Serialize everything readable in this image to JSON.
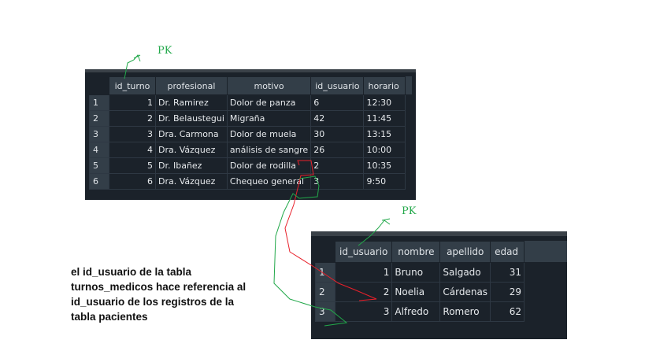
{
  "turnos_table": {
    "columns": [
      "id_turno",
      "profesional",
      "motivo",
      "id_usuario",
      "horario"
    ],
    "rows": [
      {
        "rn": "1",
        "id_turno": "1",
        "profesional": "Dr. Ramirez",
        "motivo": "Dolor de panza",
        "id_usuario": "6",
        "horario": "12:30"
      },
      {
        "rn": "2",
        "id_turno": "2",
        "profesional": "Dr. Belaustegui",
        "motivo": "Migraña",
        "id_usuario": "42",
        "horario": "11:45"
      },
      {
        "rn": "3",
        "id_turno": "3",
        "profesional": "Dra. Carmona",
        "motivo": "Dolor de muela",
        "id_usuario": "30",
        "horario": "13:15"
      },
      {
        "rn": "4",
        "id_turno": "4",
        "profesional": "Dra. Vázquez",
        "motivo": "análisis de sangre",
        "id_usuario": "26",
        "horario": "10:00"
      },
      {
        "rn": "5",
        "id_turno": "5",
        "profesional": "Dr. Ibañez",
        "motivo": "Dolor de rodilla",
        "id_usuario": "2",
        "horario": "10:35"
      },
      {
        "rn": "6",
        "id_turno": "6",
        "profesional": "Dra. Vázquez",
        "motivo": "Chequeo general",
        "id_usuario": "3",
        "horario": "9:50"
      }
    ]
  },
  "pacientes_table": {
    "columns": [
      "id_usuario",
      "nombre",
      "apellido",
      "edad"
    ],
    "rows": [
      {
        "rn": "1",
        "id_usuario": "1",
        "nombre": "Bruno",
        "apellido": "Salgado",
        "edad": "31"
      },
      {
        "rn": "2",
        "id_usuario": "2",
        "nombre": "Noelia",
        "apellido": "Cárdenas",
        "edad": "29"
      },
      {
        "rn": "3",
        "id_usuario": "3",
        "nombre": "Alfredo",
        "apellido": "Romero",
        "edad": "62"
      }
    ]
  },
  "annotations": {
    "pk_label_1": "PK",
    "pk_label_2": "PK",
    "note": "el id_usuario de la tabla turnos_medicos hace referencia al id_usuario de los registros de la tabla pacientes"
  },
  "colors": {
    "red_link": "#e8202a",
    "green_link": "#22a84a"
  }
}
